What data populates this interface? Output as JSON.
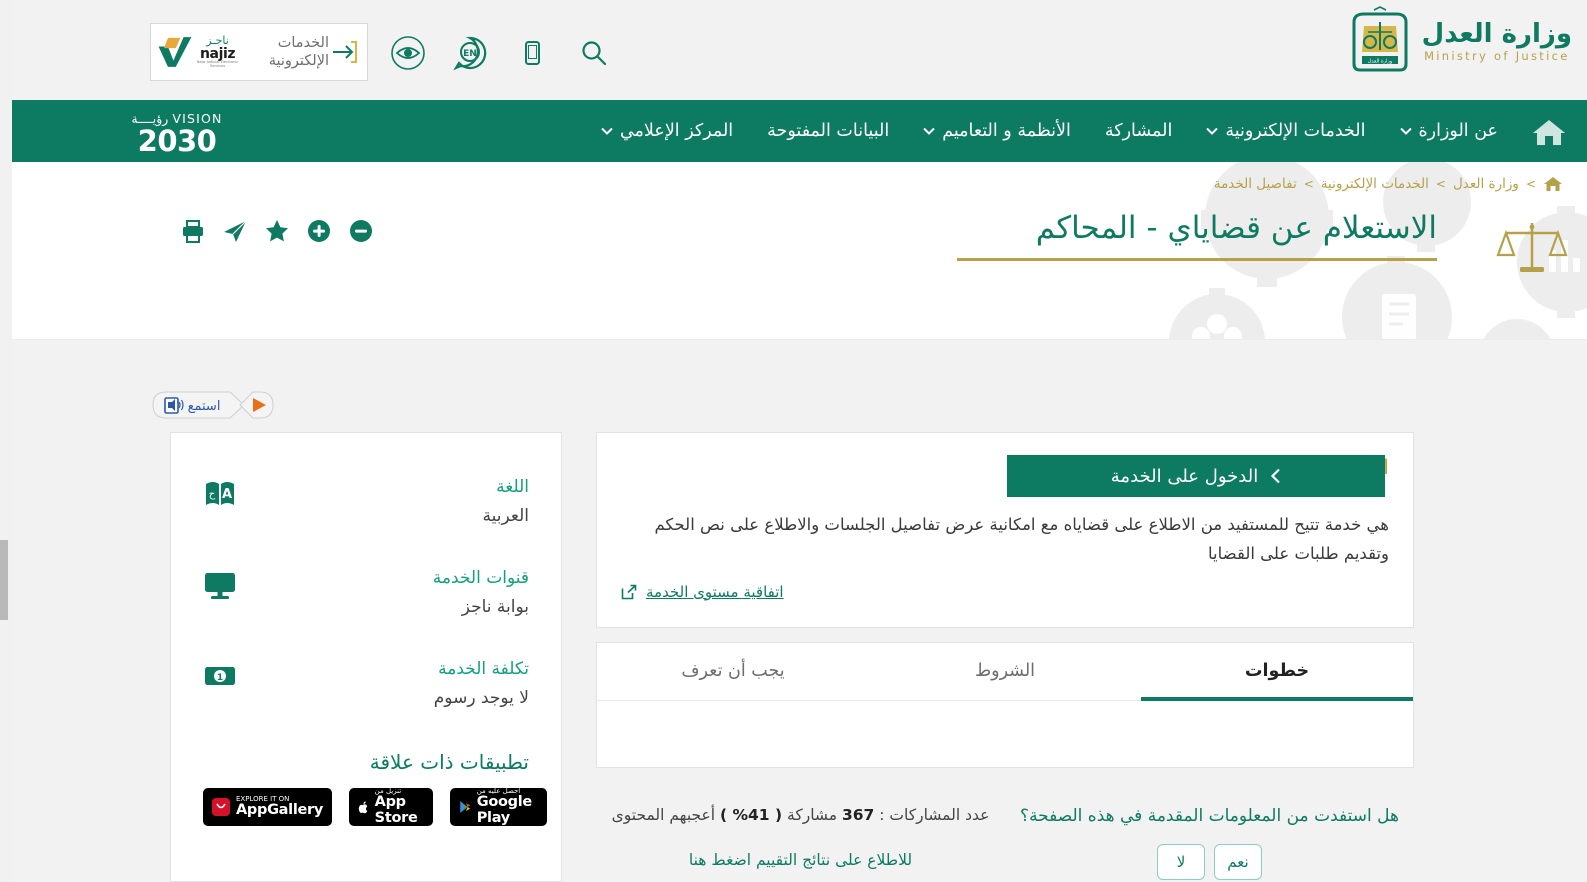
{
  "brand": {
    "ministry_ar": "وزارة العدل",
    "ministry_en": "Ministry of Justice",
    "emblem_caption": "وزارة العدل",
    "najiz_service_label": "الخدمات الإلكترونية",
    "najiz_ar": "ناجـز",
    "najiz_en": "najiz",
    "najiz_sub": "Najiz Judicial Electronic Services",
    "vision_word": "VISION",
    "vision_word_ar": "رؤيــــة",
    "vision_year": "2030",
    "green": "#0d7a62",
    "gold": "#b6a14b",
    "teal_text": "#13a07f"
  },
  "utility_icons": [
    {
      "name": "search-icon",
      "label": "بحث"
    },
    {
      "name": "mobile-icon",
      "label": "تطبيق الجوال"
    },
    {
      "name": "language-en-icon",
      "label": "EN"
    },
    {
      "name": "accessibility-eye-icon",
      "label": "إمكانية الوصول"
    }
  ],
  "nav": {
    "home_label": "الرئيسية",
    "items": [
      {
        "label": "عن الوزارة",
        "has_caret": true
      },
      {
        "label": "الخدمات الإلكترونية",
        "has_caret": true
      },
      {
        "label": "المشاركة",
        "has_caret": false
      },
      {
        "label": "الأنظمة و التعاميم",
        "has_caret": true
      },
      {
        "label": "البيانات المفتوحة",
        "has_caret": false
      },
      {
        "label": "المركز الإعلامي",
        "has_caret": true
      }
    ]
  },
  "breadcrumb": {
    "home": "الرئيسية",
    "items": [
      "وزارة العدل",
      "الخدمات الإلكترونية",
      "تفاصيل الخدمة"
    ],
    "separator": ">"
  },
  "hero": {
    "title": "الاستعلام عن قضاياي - المحاكم"
  },
  "page_actions": [
    {
      "name": "font-decrease-icon",
      "label": "تصغير الخط"
    },
    {
      "name": "font-increase-icon",
      "label": "تكبير الخط"
    },
    {
      "name": "favorite-star-icon",
      "label": "إضافة للمفضلة"
    },
    {
      "name": "share-icon",
      "label": "مشاركة"
    },
    {
      "name": "print-icon",
      "label": "طباعة"
    }
  ],
  "readspeaker": {
    "listen_label": "استمع",
    "play_label": "تشغيل"
  },
  "service": {
    "card_title": "الاستعلام عن قضاياي - المحاكم",
    "cta_label": "الدخول على الخدمة",
    "description": "هي خدمة تتيح للمستفيد من الاطلاع على قضاياه مع امكانية عرض تفاصيل الجلسات والاطلاع على نص الحكم وتقديم طلبات على القضايا",
    "sla_link": "اتفاقية مستوى الخدمة"
  },
  "tabs": [
    {
      "label": "خطوات",
      "active": true
    },
    {
      "label": "الشروط",
      "active": false
    },
    {
      "label": "يجب أن تعرف",
      "active": false
    }
  ],
  "sidebar": {
    "rows": [
      {
        "icon": "language-book-icon",
        "label": "اللغة",
        "value": "العربية"
      },
      {
        "icon": "monitor-icon",
        "label": "قنوات الخدمة",
        "value": "بوابة ناجز"
      },
      {
        "icon": "money-note-icon",
        "label": "تكلفة الخدمة",
        "value": "لا يوجد رسوم"
      }
    ],
    "apps_title": "تطبيقات ذات علاقة",
    "app_badges": [
      {
        "name": "appgallery-badge",
        "small": "EXPLORE IT ON",
        "large": "AppGallery"
      },
      {
        "name": "appstore-badge",
        "small": "تنزيل من",
        "large": "App Store"
      },
      {
        "name": "googleplay-badge",
        "small": "احصل عليه من",
        "large": "Google Play"
      }
    ]
  },
  "feedback": {
    "question": "هل استفدت من المعلومات المقدمة في هذه الصفحة؟",
    "yes_label": "نعم",
    "no_label": "لا",
    "count_prefix": "عدد المشاركات :",
    "count_value": "367",
    "count_unit": "مشاركة",
    "percent": "( 41% )",
    "count_suffix": "أعجبهم المحتوى",
    "results_link": "للاطلاع على نتائج التقييم اضغط هنا"
  }
}
